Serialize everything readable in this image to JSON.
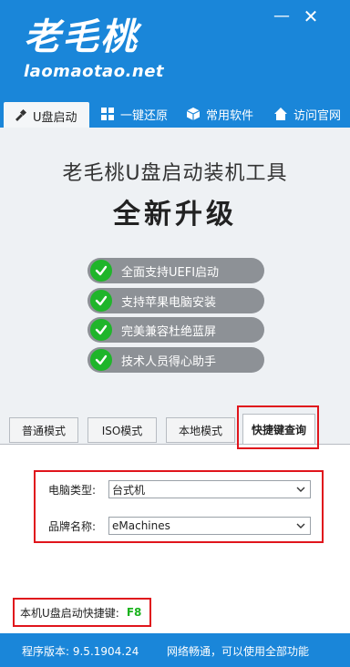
{
  "app": {
    "logo_cn": "老毛桃",
    "logo_en": "laomaotao.net"
  },
  "window": {
    "minimize_label": "—",
    "close_label": "✕"
  },
  "nav": [
    {
      "label": "U盘启动",
      "icon": "usb-icon"
    },
    {
      "label": "一键还原",
      "icon": "windows-icon"
    },
    {
      "label": "常用软件",
      "icon": "box-icon"
    },
    {
      "label": "访问官网",
      "icon": "home-icon"
    }
  ],
  "hero": {
    "title": "老毛桃U盘启动装机工具",
    "subtitle": "全新升级",
    "features": [
      "全面支持UEFI启动",
      "支持苹果电脑安装",
      "完美兼容杜绝蓝屏",
      "技术人员得心助手"
    ]
  },
  "tabs": [
    "普通模式",
    "ISO模式",
    "本地模式",
    "快捷键查询"
  ],
  "form": {
    "computer_type_label": "电脑类型:",
    "computer_type_value": "台式机",
    "brand_label": "品牌名称:",
    "brand_value": "eMachines"
  },
  "hotkey": {
    "label": "本机U盘启动快捷键:",
    "key": "F8"
  },
  "status": {
    "version": "程序版本: 9.5.1904.24",
    "network": "网络畅通，可以使用全部功能"
  },
  "colors": {
    "primary": "#1a86d9",
    "check_green": "#1fb52a",
    "highlight_red": "#e0151c",
    "hotkey_green": "#1bb31e"
  }
}
